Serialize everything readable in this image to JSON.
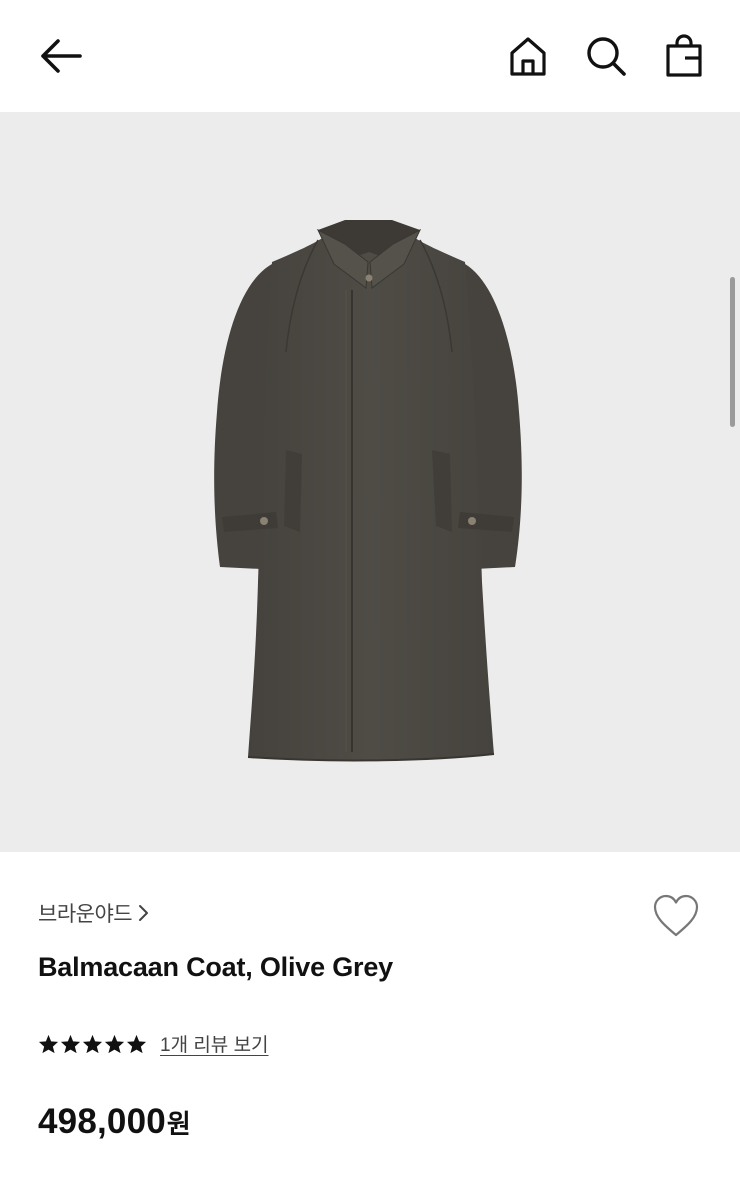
{
  "header": {
    "back_icon": "arrow-left-icon",
    "home_icon": "home-icon",
    "search_icon": "search-icon",
    "bag_icon": "shopping-bag-icon"
  },
  "product": {
    "image_subject": "coat",
    "brand": "브라운야드",
    "brand_chevron_icon": "chevron-right-icon",
    "wishlist_icon": "heart-outline-icon",
    "title": "Balmacaan Coat, Olive Grey",
    "rating": {
      "stars": 5,
      "max_stars": 5,
      "review_link": "1개 리뷰 보기"
    },
    "price": {
      "amount": "498,000",
      "currency": "원"
    }
  },
  "colors": {
    "text_primary": "#111111",
    "text_secondary": "#444444",
    "image_background": "#ececec",
    "coat": "#4b4843"
  }
}
